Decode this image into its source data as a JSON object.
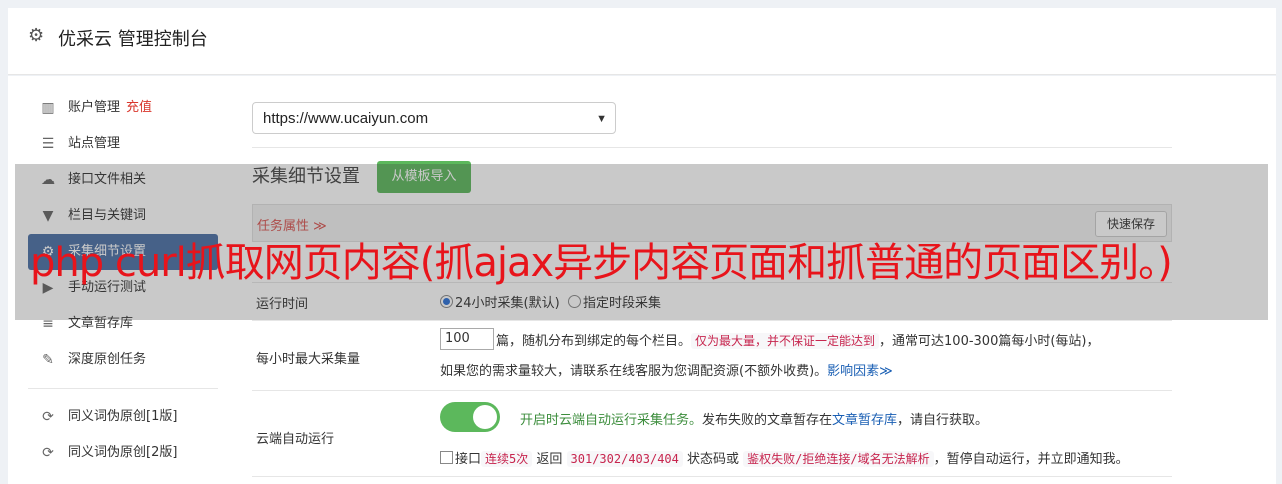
{
  "header": {
    "icon": "gear-icon",
    "title": "优采云 管理控制台"
  },
  "sidebar": {
    "items": [
      {
        "icon": "bar-chart-icon",
        "glyph": "▥",
        "label": "账户管理",
        "extra": "充值"
      },
      {
        "icon": "server-icon",
        "glyph": "☰",
        "label": "站点管理"
      },
      {
        "icon": "cloud-upload-icon",
        "glyph": "☁",
        "label": "接口文件相关"
      },
      {
        "icon": "filter-icon",
        "glyph": "▼",
        "label": "栏目与关键词"
      },
      {
        "icon": "gears-icon",
        "glyph": "⚙",
        "label": "采集细节设置"
      },
      {
        "icon": "play-circle-icon",
        "glyph": "▶",
        "label": "手动运行测试"
      },
      {
        "icon": "database-icon",
        "glyph": "≡",
        "label": "文章暂存库"
      },
      {
        "icon": "edit-icon",
        "glyph": "✎",
        "label": "深度原创任务"
      }
    ],
    "items2": [
      {
        "icon": "refresh-icon",
        "glyph": "⟳",
        "label": "同义词伪原创[1版]"
      },
      {
        "icon": "refresh-icon",
        "glyph": "⟳",
        "label": "同义词伪原创[2版]"
      }
    ]
  },
  "main": {
    "site_select": "https://www.ucaiyun.com",
    "section_title": "采集细节设置",
    "import_button": "从模板导入",
    "task_label": "任务属性 ≫",
    "save_button": "快速保存",
    "run_time": {
      "label": "运行时间",
      "opt1": "24小时采集(默认)",
      "opt2": "指定时段采集"
    },
    "max_per_hour": {
      "label": "每小时最大采集量",
      "value": "100",
      "text1": "篇，随机分布到绑定的每个栏目。",
      "code1": "仅为最大量，并不保证一定能达到",
      "text2": "，通常可达100-300篇每小时(每站)，",
      "text3": "如果您的需求量较大，请联系在线客服为您调配资源(不额外收费)。",
      "link": "影响因素≫"
    },
    "auto_run": {
      "label": "云端自动运行",
      "green": "开启时云端自动运行采集任务。",
      "text1": "发布失败的文章暂存在",
      "link": "文章暂存库",
      "text2": "，请自行获取。",
      "chk_label": "接口",
      "code1": "连续5次",
      "text3": " 返回 ",
      "code2": "301/302/403/404",
      "text4": " 状态码或 ",
      "code3": "鉴权失败/拒绝连接/域名无法解析",
      "text5": "，暂停自动运行，并立即通知我。"
    }
  },
  "overlay": {
    "headline": "php curl抓取网页内容(抓ajax异步内容页面和抓普通的页面区别。)"
  }
}
